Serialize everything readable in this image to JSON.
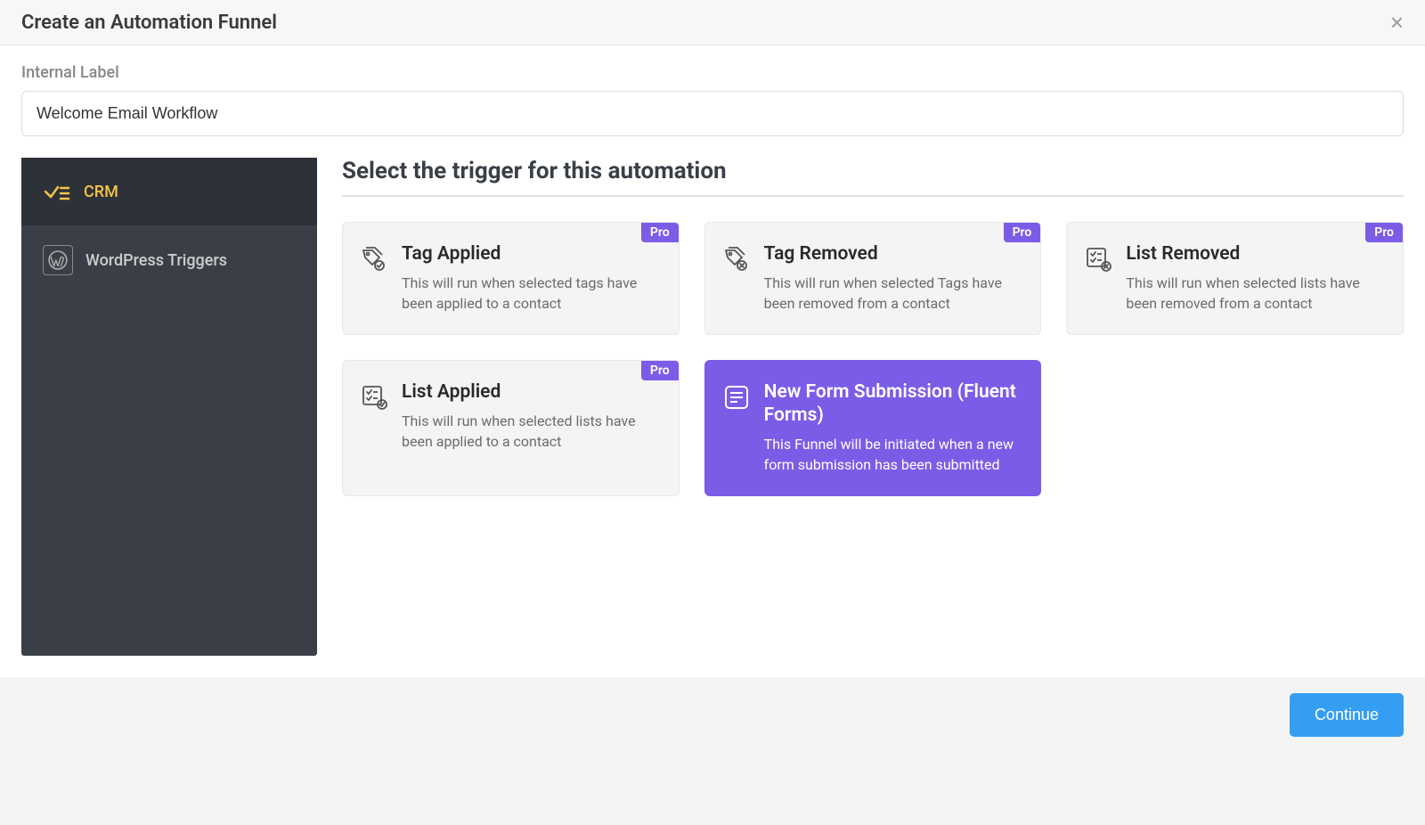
{
  "modal": {
    "title": "Create an Automation Funnel"
  },
  "form": {
    "internal_label_text": "Internal Label",
    "internal_label_value": "Welcome Email Workflow"
  },
  "sidebar": {
    "items": [
      {
        "label": "CRM",
        "active": true
      },
      {
        "label": "WordPress Triggers",
        "active": false
      }
    ]
  },
  "content": {
    "heading": "Select the trigger for this automation",
    "pro_badge": "Pro",
    "triggers": [
      {
        "title": "Tag Applied",
        "desc": "This will run when selected tags have been applied to a contact",
        "pro": true,
        "selected": false
      },
      {
        "title": "Tag Removed",
        "desc": "This will run when selected Tags have been removed from a contact",
        "pro": true,
        "selected": false
      },
      {
        "title": "List Removed",
        "desc": "This will run when selected lists have been removed from a contact",
        "pro": true,
        "selected": false
      },
      {
        "title": "List Applied",
        "desc": "This will run when selected lists have been applied to a contact",
        "pro": true,
        "selected": false
      },
      {
        "title": "New Form Submission (Fluent Forms)",
        "desc": "This Funnel will be initiated when a new form submission has been submitted",
        "pro": false,
        "selected": true
      }
    ]
  },
  "footer": {
    "continue_label": "Continue"
  }
}
